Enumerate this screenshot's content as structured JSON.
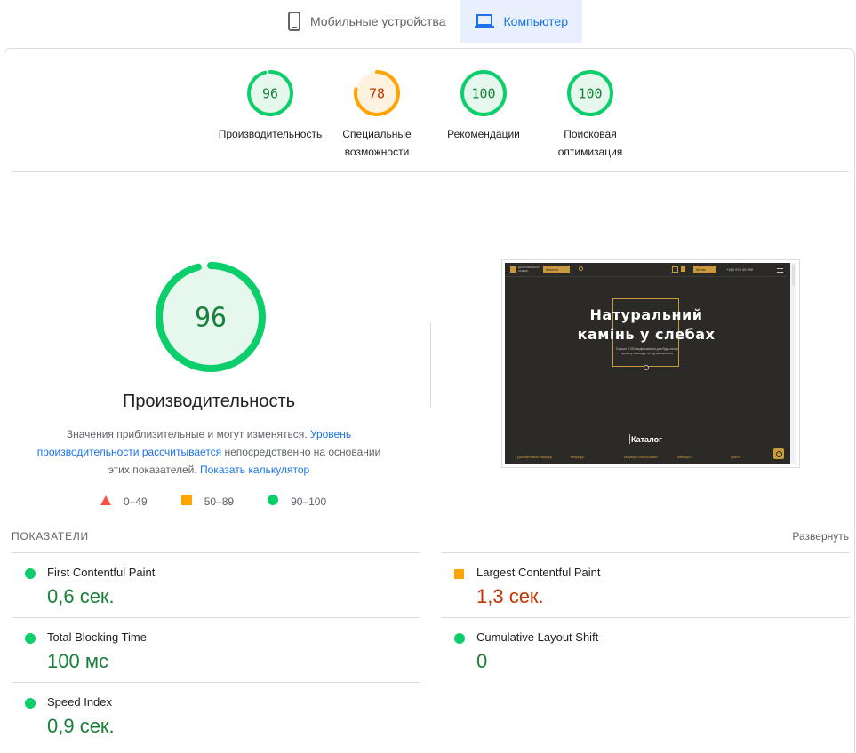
{
  "device_tabs": {
    "mobile": {
      "label": "Мобильные устройства",
      "icon": "smartphone-icon"
    },
    "desktop": {
      "label": "Компьютер",
      "icon": "laptop-icon",
      "active": true
    }
  },
  "colors": {
    "good": "#0cce6b",
    "good_bg": "#e6f8ed",
    "good_text": "#188038",
    "average": "#ffa400",
    "average_bg": "#fff3e0",
    "average_text": "#c33300",
    "poor": "#ff4e42",
    "accent": "#1a73e8"
  },
  "gauges": [
    {
      "score": "96",
      "value": 96,
      "label": "Производительность",
      "rating": "good"
    },
    {
      "score": "78",
      "value": 78,
      "label": "Специальные возможности",
      "rating": "average"
    },
    {
      "score": "100",
      "value": 100,
      "label": "Рекомендации",
      "rating": "good"
    },
    {
      "score": "100",
      "value": 100,
      "label": "Поисковая оптимизация",
      "rating": "good"
    }
  ],
  "performance": {
    "score": "96",
    "value": 96,
    "title": "Производительность",
    "desc_part1": "Значения приблизительные и могут изменяться. ",
    "desc_link1": "Уровень производительности рассчитывается",
    "desc_part2": " непосредственно на основании этих показателей. ",
    "desc_link2": "Показать калькулятор"
  },
  "legend": [
    {
      "range": "0–49",
      "shape": "triangle-icon"
    },
    {
      "range": "50–89",
      "shape": "square-icon"
    },
    {
      "range": "90–100",
      "shape": "circle-icon"
    }
  ],
  "screenshot": {
    "logo_text": "ДНІПРОВСЬКИЙ КАМІНЬ",
    "catalog_btn": "Каталог",
    "nav_btn": "Меню",
    "phone": "+380 970 00 099",
    "hero_line1": "Натуральний",
    "hero_line2": "камінь у слебах",
    "hero_sub": "Більше 3 000 видів каміння для будь-якого проєкту зі складу та під замовлення",
    "catalog_heading": "Каталог",
    "categories": [
      "Доломітовий мармур",
      "Мармур",
      "Мармур кольоровий",
      "Кварцит",
      "Граніт"
    ]
  },
  "metrics": {
    "title": "ПОКАЗАТЕЛИ",
    "expand": "Развернуть",
    "items": [
      {
        "name": "First Contentful Paint",
        "value": "0,6 сек.",
        "rating": "good"
      },
      {
        "name": "Largest Contentful Paint",
        "value": "1,3 сек.",
        "rating": "average"
      },
      {
        "name": "Total Blocking Time",
        "value": "100 мс",
        "rating": "good"
      },
      {
        "name": "Cumulative Layout Shift",
        "value": "0",
        "rating": "good"
      },
      {
        "name": "Speed Index",
        "value": "0,9 сек.",
        "rating": "good"
      }
    ]
  }
}
